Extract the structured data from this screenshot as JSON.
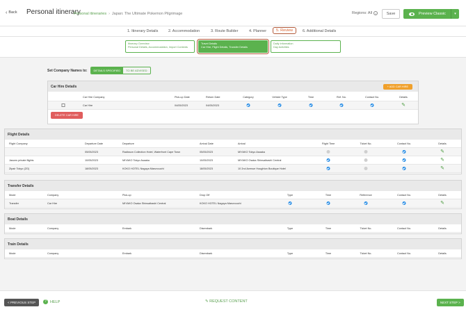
{
  "header": {
    "back_label": "Back",
    "title": "Personal itinerary",
    "breadcrumbs": [
      "Personal itineraries",
      "Japan: The Ultimate Pokemon Pilgrimage"
    ],
    "regions_label": "Regions: All",
    "save_label": "Save",
    "preview_label": "Preview Classic"
  },
  "steps": [
    "1. Itinerary Details",
    "2. Accommodation",
    "3. Route Builder",
    "4. Planner",
    "5. Review",
    "6. Additional Details"
  ],
  "substeps": [
    {
      "line1": "Itinerary Overview",
      "line2": "Personal Details, Accommodation, Import Contents"
    },
    {
      "line1": "Travel Details",
      "line2": "Car Hire, Flight Details, Transfer Details"
    },
    {
      "line1": "Daily Information",
      "line2": "Day Activities"
    }
  ],
  "company_names": {
    "label": "Set Company Names to:",
    "option_specified": "DETAILS SPECIFIED",
    "option_advised": "TO BE ADVISED"
  },
  "car_hire": {
    "title": "Car Hire Details",
    "add_label": "+ ADD CAR HIRE",
    "delete_label": "DELETE CAR HIRE",
    "columns": [
      "Car Hire Company",
      "Pick-up Date",
      "Return Date",
      "Category",
      "Vehicle Type",
      "Time",
      "Ref. No.",
      "Contact No.",
      "Details"
    ],
    "rows": [
      {
        "company": "Car Hire",
        "pickup": "04/05/2023",
        "return": "04/05/2023"
      }
    ]
  },
  "flights": {
    "title": "Flight Details",
    "columns": [
      "Flight Company",
      "Departure Date",
      "Departure",
      "Arrival Date",
      "Arrival",
      "Flight Time",
      "Ticket No.",
      "Contact No.",
      "Details"
    ],
    "rows": [
      {
        "company": "",
        "dep_date": "05/05/2023",
        "departure": "Radisson Collection Hotel, Waterfront Cape Town",
        "arr_date": "05/05/2023",
        "arrival": "MIYAKO Tokyo Asaaka",
        "flight_time": false,
        "ticket": false,
        "contact": true
      },
      {
        "company": "Jasons private flights",
        "dep_date": "10/05/2023",
        "departure": "MIYAKO Tokyo Asaaka",
        "arr_date": "10/05/2023",
        "arrival": "MIYAKO Osaka Shinsaibashi Central",
        "flight_time": true,
        "ticket": false,
        "contact": true
      },
      {
        "company": "Zipair Tokyo (ZG)",
        "dep_date": "18/05/2023",
        "departure": "KOKO HOTEL Nagoya Marunouchi",
        "arr_date": "18/05/2023",
        "arrival": "10 2nd Avenue Houghton Boutique Hotel",
        "flight_time": true,
        "ticket": false,
        "contact": true
      }
    ]
  },
  "transfers": {
    "title": "Transfer Details",
    "columns": [
      "Mode",
      "Company",
      "Pick-up",
      "Drop Off",
      "Type",
      "Time",
      "Reference",
      "Contact No.",
      "Details"
    ],
    "rows": [
      {
        "mode": "Transfer",
        "company": "Car Hire",
        "pickup": "MIYAKO Osaka Shinsaibashi Central",
        "dropoff": "KOKO HOTEL Nagoya Marunouchi"
      }
    ]
  },
  "boats": {
    "title": "Boat Details",
    "columns": [
      "Mode",
      "Company",
      "Embark",
      "Disembark",
      "Type",
      "Time",
      "Ticket No.",
      "Contact No.",
      "Details"
    ]
  },
  "trains": {
    "title": "Train Details",
    "columns": [
      "Mode",
      "Company",
      "Embark",
      "Disembark",
      "Type",
      "Time",
      "Ticket No.",
      "Contact No.",
      "Details"
    ]
  },
  "footer": {
    "prev_label": "< PREVIOUS STEP",
    "help_label": "HELP",
    "request_label": "REQUEST CONTENT",
    "next_label": "NEXT STEP >"
  },
  "colors": {
    "accent": "#5bb24e",
    "orange": "#f0a02b",
    "red": "#e05d5d",
    "check": "#1e88e5",
    "highlight": "#b35a3a"
  }
}
